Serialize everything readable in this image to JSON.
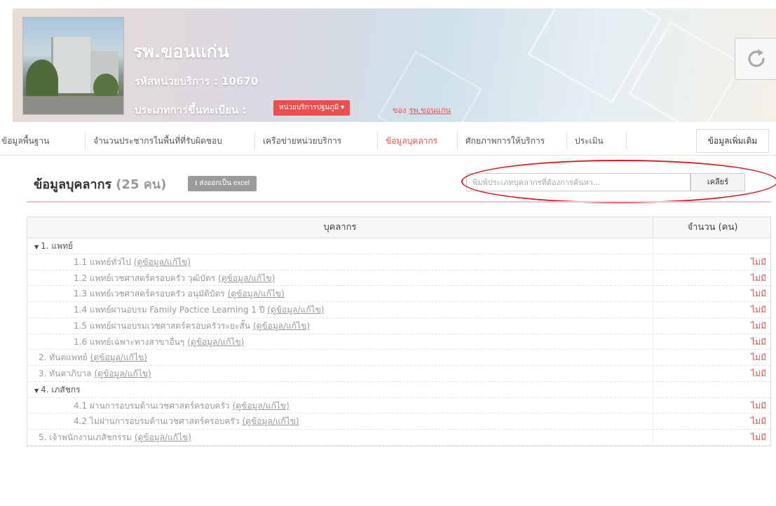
{
  "header": {
    "hospital_name": "รพ.ขอนแก่น",
    "service_code": "รหัสหน่วยบริการ : 10670",
    "registration_label": "ประเภทการขึ้นทะเบียน :",
    "registration_type": "หน่วยบริการปฐมภูมิ ▾",
    "owner_prefix": "ของ",
    "owner_link": "รพ.ขอนแก่น"
  },
  "nav": {
    "tabs": [
      {
        "label": "ข้อมูลพื้นฐาน",
        "active": false
      },
      {
        "label": "จำนวนประชากรในพื้นที่ที่รับผิดชอบ",
        "active": false
      },
      {
        "label": "เครือข่ายหน่วยบริการ",
        "active": false
      },
      {
        "label": "ข้อมูลบุคลากร",
        "active": true
      },
      {
        "label": "ศักยภาพการให้บริการ",
        "active": false
      },
      {
        "label": "ประเมิน",
        "active": false
      }
    ],
    "more": "ข้อมูลเพิ่มเติม"
  },
  "section": {
    "title": "ข้อมูลบุคลากร",
    "count": "(25 คน)",
    "export_label": "⭳ ส่งออกเป็น excel",
    "search_placeholder": "พิมพ์ประเภทบุคลากรที่ต้องการค้นหา...",
    "clear_label": "เคลียร์"
  },
  "table": {
    "headers": {
      "person": "บุคลากร",
      "count": "จำนวน (คน)"
    },
    "link_text": "(ดูข้อมูล/แก้ไข)",
    "rows": [
      {
        "label": "1. แพทย์",
        "group": true,
        "value": ""
      },
      {
        "label": "1.1 แพทย์ทั่วไป",
        "group": false,
        "value": "ไม่มี"
      },
      {
        "label": "1.2 แพทย์เวชศาสตร์ครอบครัว วุฒิบัตร",
        "group": false,
        "value": "ไม่มี"
      },
      {
        "label": "1.3 แพทย์เวชศาสตร์ครอบครัว อนุมัติบัตร",
        "group": false,
        "value": "ไม่มี"
      },
      {
        "label": "1.4 แพทย์ผ่านอบรม Family Pactice Learning 1 ปี",
        "group": false,
        "value": "ไม่มี"
      },
      {
        "label": "1.5 แพทย์ผ่านอบรมเวชศาสตร์ครอบครัวระยะสั้น",
        "group": false,
        "value": "ไม่มี"
      },
      {
        "label": "1.6 แพทย์เฉพาะทางสาขาอื่นๆ",
        "group": false,
        "value": "ไม่มี"
      },
      {
        "label": "2. ทันตแพทย์",
        "group": false,
        "value": "ไม่มี"
      },
      {
        "label": "3. ทันตาภิบาล",
        "group": false,
        "value": "ไม่มี"
      },
      {
        "label": "4. เภสัชกร",
        "group": true,
        "value": ""
      },
      {
        "label": "4.1 ผ่านการอบรมด้านเวชศาสตร์ครอบครัว",
        "group": false,
        "value": "ไม่มี"
      },
      {
        "label": "4.2 ไม่ผ่านการอบรมด้านเวชศาสตร์ครอบครัว",
        "group": false,
        "value": "ไม่มี"
      },
      {
        "label": "5. เจ้าพนักงานเภสัชกรรม",
        "group": false,
        "value": "ไม่มี"
      }
    ]
  },
  "colors": {
    "accent": "#e8504f",
    "muted": "#9a9a9a",
    "annotation": "#d91c1c"
  }
}
